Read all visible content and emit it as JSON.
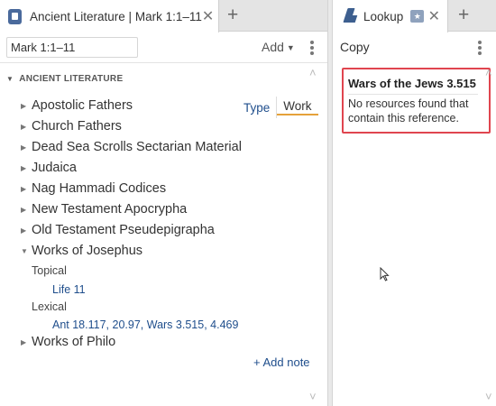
{
  "left": {
    "tab": {
      "title": "Ancient Literature | Mark 1:1–11",
      "close": "✕",
      "add": "+"
    },
    "toolbar": {
      "reference": "Mark 1:1–11",
      "add_label": "Add",
      "add_caret": "▼"
    },
    "section": {
      "title": "ANCIENT LITERATURE"
    },
    "view_toggle": {
      "type": "Type",
      "work": "Work",
      "selected": "Work"
    },
    "tree": [
      {
        "label": "Apostolic Fathers",
        "expanded": false
      },
      {
        "label": "Church Fathers",
        "expanded": false
      },
      {
        "label": "Dead Sea Scrolls Sectarian Material",
        "expanded": false
      },
      {
        "label": "Judaica",
        "expanded": false
      },
      {
        "label": "Nag Hammadi Codices",
        "expanded": false
      },
      {
        "label": "New Testament Apocrypha",
        "expanded": false
      },
      {
        "label": "Old Testament Pseudepigrapha",
        "expanded": false
      },
      {
        "label": "Works of Josephus",
        "expanded": true
      },
      {
        "label": "Works of Philo",
        "expanded": false
      }
    ],
    "josephus": {
      "topical_label": "Topical",
      "topical_links": [
        "Life 11"
      ],
      "lexical_label": "Lexical",
      "lexical_links": [
        "Ant 18.117",
        "20.97",
        "Wars 3.515",
        "4.469"
      ]
    },
    "add_note": "+ Add note"
  },
  "right": {
    "tab": {
      "title": "Lookup",
      "close": "✕",
      "add": "+"
    },
    "copy_label": "Copy",
    "result": {
      "title": "Wars of the Jews 3.515",
      "message": "No resources found that contain this reference."
    }
  },
  "colors": {
    "link": "#1f4e8c",
    "highlight_border": "#e0454f",
    "selected_underline": "#e5a13a",
    "brand_icon": "#4a6a9c"
  }
}
